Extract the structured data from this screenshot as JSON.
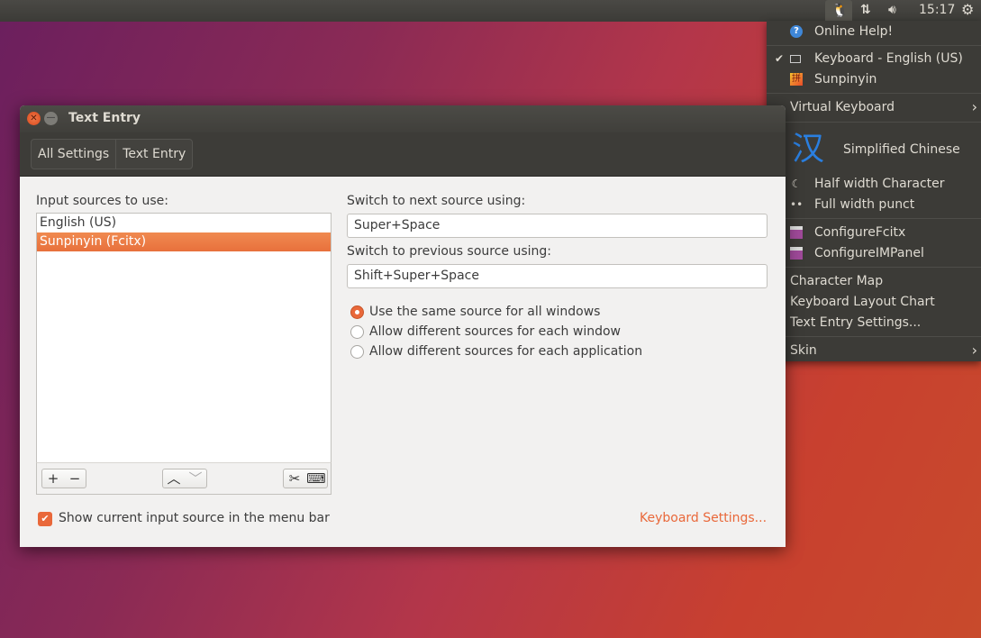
{
  "topbar": {
    "clock": "15:17",
    "icons": [
      "tux-fcitx-icon",
      "network-icon",
      "volume-icon",
      "power-gear-icon"
    ]
  },
  "menu": {
    "online_help": "Online Help!",
    "keyboard_english": "Keyboard - English (US)",
    "keyboard_english_checked": true,
    "sunpinyin": "Sunpinyin",
    "virtual_keyboard": "Virtual Keyboard",
    "simplified_chinese_glyph": "汉",
    "simplified_chinese": "Simplified Chinese",
    "half_width": "Half width Character",
    "full_width": "Full width punct",
    "configure_fcitx": "ConfigureFcitx",
    "configure_impanel": "ConfigureIMPanel",
    "character_map": "Character Map",
    "keyboard_layout_chart": "Keyboard Layout Chart",
    "text_entry_settings": "Text Entry Settings...",
    "skin": "Skin"
  },
  "window": {
    "title": "Text Entry",
    "breadcrumbs": [
      "All Settings",
      "Text Entry"
    ],
    "input_sources_label": "Input sources to use:",
    "input_sources": [
      "English (US)",
      "Sunpinyin (Fcitx)"
    ],
    "selected_source": "Sunpinyin (Fcitx)",
    "next_label": "Switch to next source using:",
    "next_value": "Super+Space",
    "prev_label": "Switch to previous source using:",
    "prev_value": "Shift+Super+Space",
    "radio_options": [
      "Use the same source for all windows",
      "Allow different sources for each window",
      "Allow different sources for each application"
    ],
    "radio_selected": "Use the same source for all windows",
    "show_in_menubar": "Show current input source in the menu bar",
    "show_in_menubar_checked": true,
    "keyboard_settings": "Keyboard Settings...",
    "accent": "#e9683a"
  }
}
